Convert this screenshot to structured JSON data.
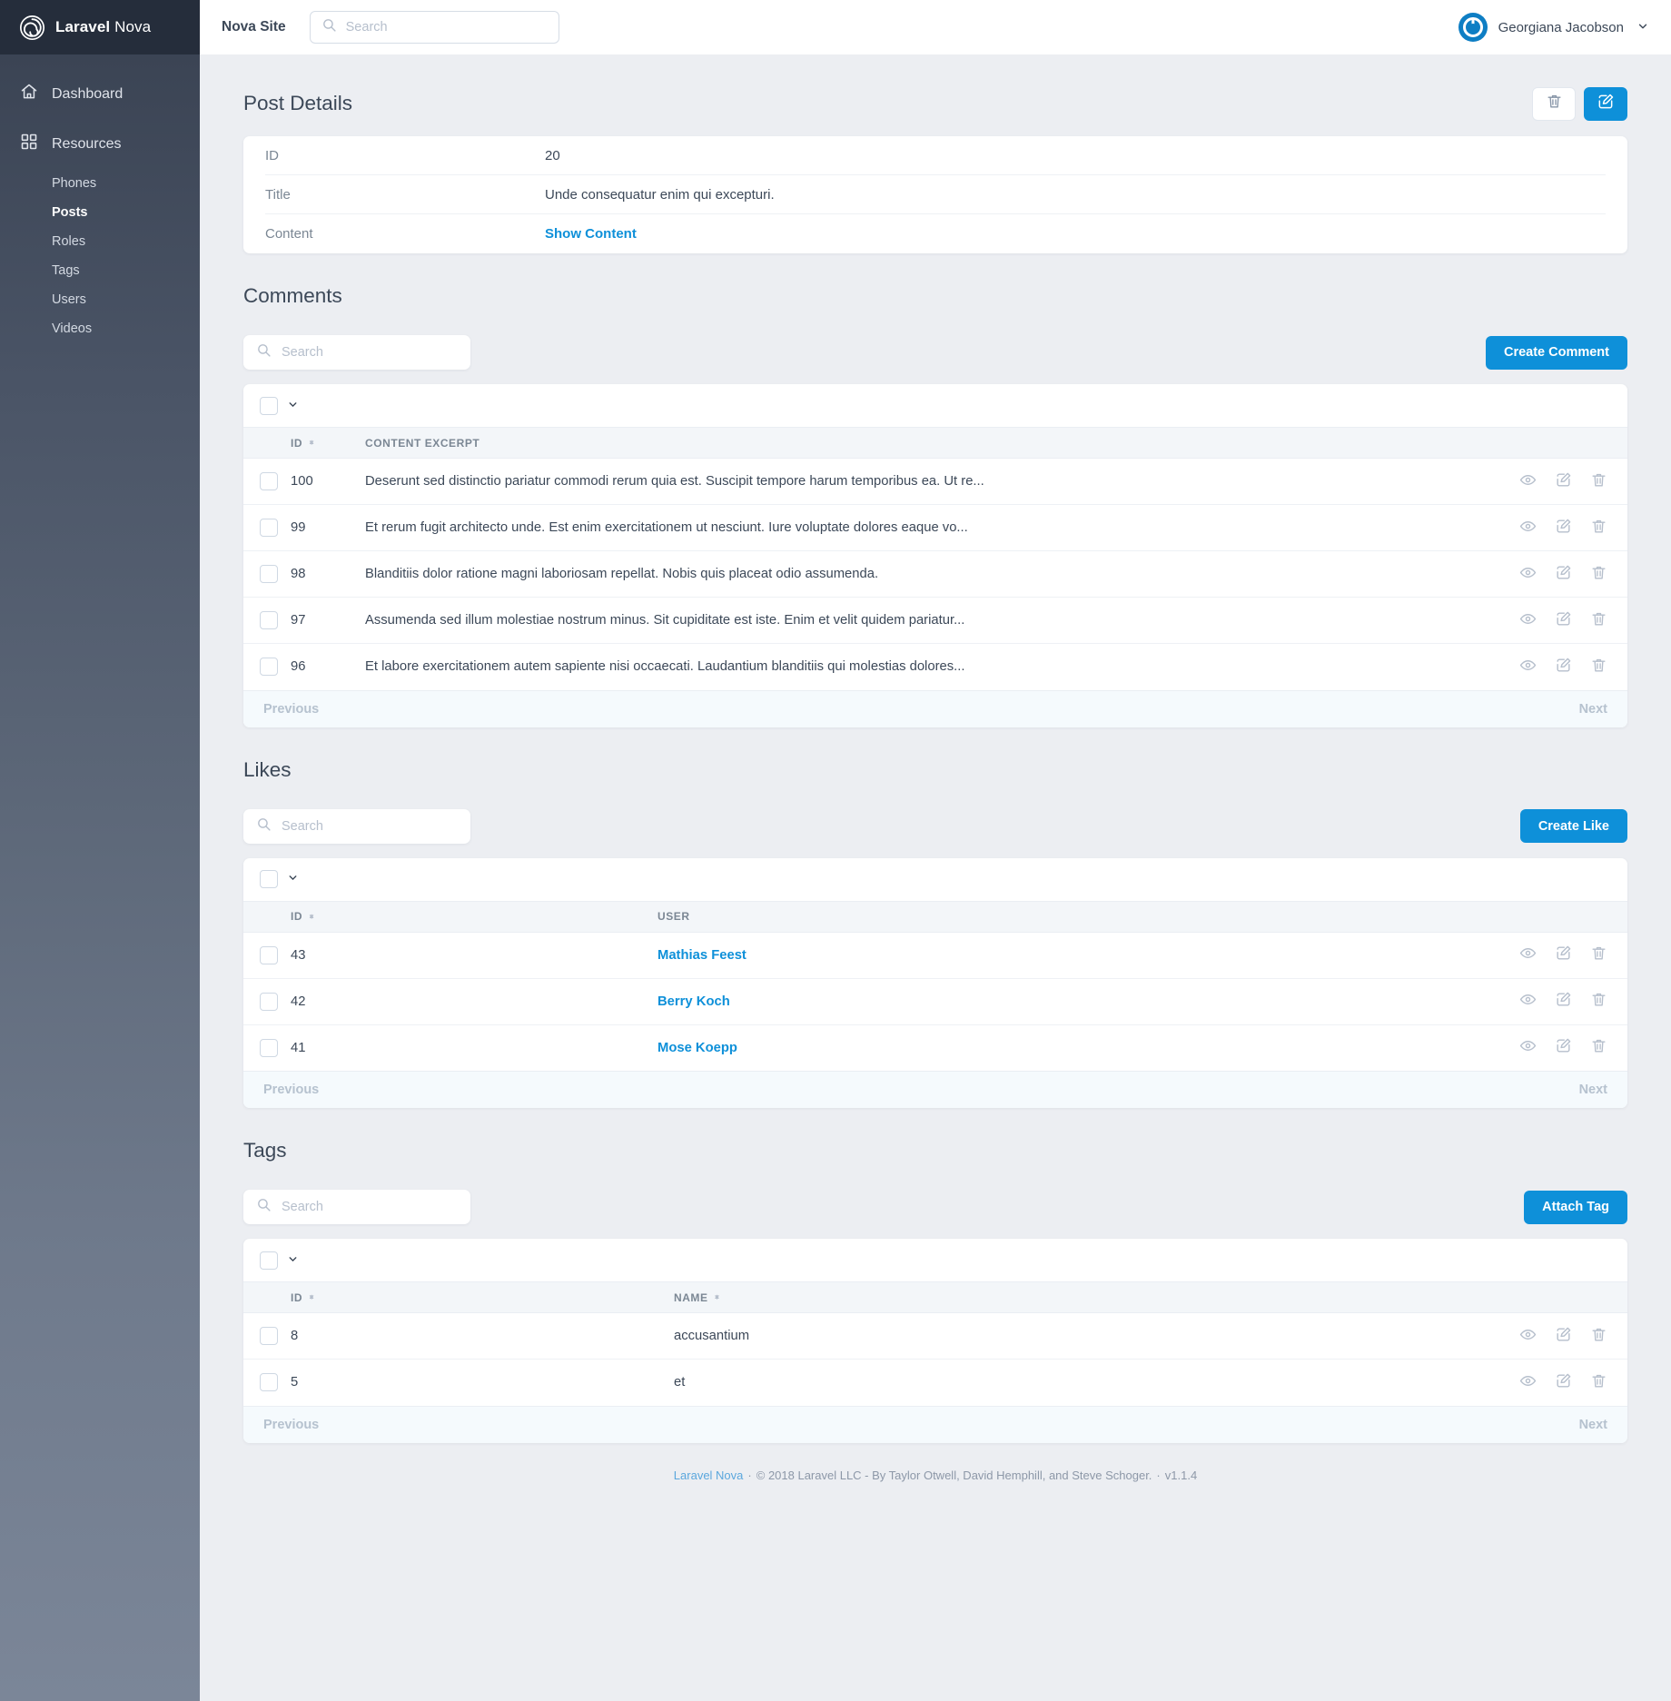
{
  "sidebar": {
    "brand": {
      "strong": "Laravel",
      "light": "Nova",
      "logo_icon": "nova-spiral-logo"
    },
    "dashboard": {
      "label": "Dashboard",
      "icon": "home-icon"
    },
    "resources": {
      "label": "Resources",
      "icon": "grid-icon"
    },
    "resource_items": [
      {
        "label": "Phones",
        "active": false
      },
      {
        "label": "Posts",
        "active": true
      },
      {
        "label": "Roles",
        "active": false
      },
      {
        "label": "Tags",
        "active": false
      },
      {
        "label": "Users",
        "active": false
      },
      {
        "label": "Videos",
        "active": false
      }
    ]
  },
  "topbar": {
    "site_title": "Nova Site",
    "search_placeholder": "Search",
    "search_value": "",
    "search_icon": "search-icon",
    "user_name": "Georgiana Jacobson",
    "caret_icon": "chevron-down-icon",
    "avatar_icon": "user-avatar"
  },
  "detail": {
    "title": "Post Details",
    "delete_icon": "trash-icon",
    "edit_icon": "pencil-square-icon",
    "fields": [
      {
        "label": "ID",
        "value": "20",
        "is_link": false
      },
      {
        "label": "Title",
        "value": "Unde consequatur enim qui excepturi.",
        "is_link": false
      },
      {
        "label": "Content",
        "value": "Show Content",
        "is_link": true
      }
    ]
  },
  "comments": {
    "title": "Comments",
    "search_placeholder": "Search",
    "search_value": "",
    "create_label": "Create Comment",
    "columns": [
      "ID",
      "Content Excerpt"
    ],
    "rows": [
      {
        "id": "100",
        "main": "Deserunt sed distinctio pariatur commodi rerum quia est. Suscipit tempore harum temporibus ea. Ut re..."
      },
      {
        "id": "99",
        "main": "Et rerum fugit architecto unde. Est enim exercitationem ut nesciunt. Iure voluptate dolores eaque vo..."
      },
      {
        "id": "98",
        "main": "Blanditiis dolor ratione magni laboriosam repellat. Nobis quis placeat odio assumenda."
      },
      {
        "id": "97",
        "main": "Assumenda sed illum molestiae nostrum minus. Sit cupiditate est iste. Enim et velit quidem pariatur..."
      },
      {
        "id": "96",
        "main": "Et labore exercitationem autem sapiente nisi occaecati. Laudantium blanditiis qui molestias dolores..."
      }
    ],
    "prev_label": "Previous",
    "next_label": "Next"
  },
  "likes": {
    "title": "Likes",
    "search_placeholder": "Search",
    "search_value": "",
    "create_label": "Create Like",
    "columns": [
      "ID",
      "User"
    ],
    "rows": [
      {
        "id": "43",
        "main": "Mathias Feest"
      },
      {
        "id": "42",
        "main": "Berry Koch"
      },
      {
        "id": "41",
        "main": "Mose Koepp"
      }
    ],
    "prev_label": "Previous",
    "next_label": "Next"
  },
  "tags": {
    "title": "Tags",
    "search_placeholder": "Search",
    "search_value": "",
    "create_label": "Attach Tag",
    "columns": [
      "ID",
      "Name"
    ],
    "rows": [
      {
        "id": "8",
        "main": "accusantium"
      },
      {
        "id": "5",
        "main": "et"
      }
    ],
    "prev_label": "Previous",
    "next_label": "Next"
  },
  "row_action_icons": {
    "view": "eye-icon",
    "edit": "pencil-square-icon",
    "delete": "trash-icon"
  },
  "footer": {
    "brand_link": "Laravel Nova",
    "copyright": "© 2018 Laravel LLC - By Taylor Otwell, David Hemphill, and Steve Schoger.",
    "version": "v1.1.4",
    "separator": "·"
  },
  "colors": {
    "accent": "#0e90d9",
    "sidebar_top": "#363f4e",
    "sidebar_brand": "#252d3b",
    "page_bg": "#eceef2",
    "text": "#3c4858",
    "muted": "#7b8794"
  }
}
